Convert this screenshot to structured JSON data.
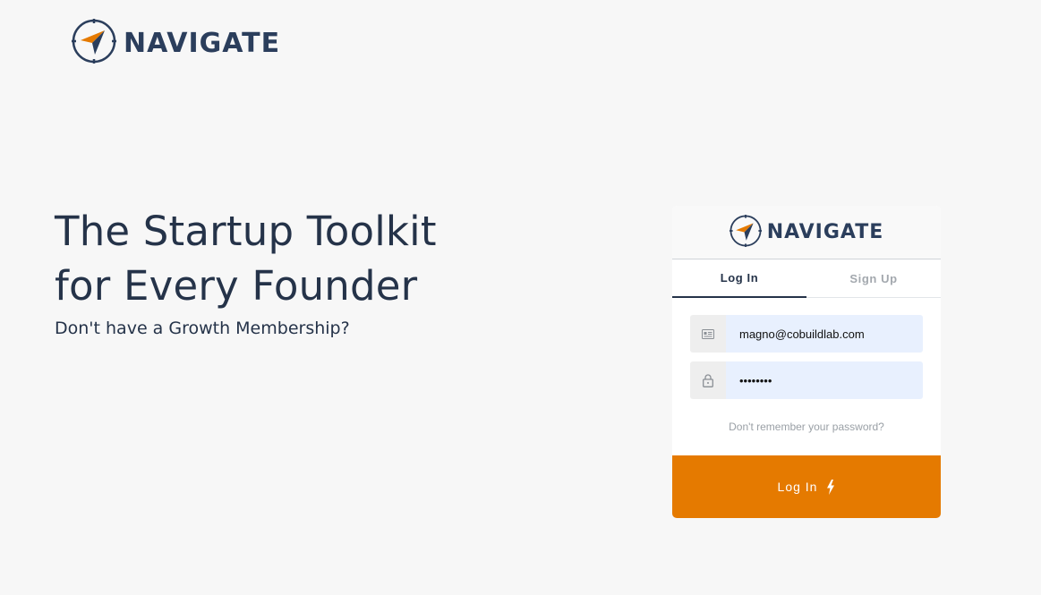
{
  "brand": {
    "name": "NAVIGATE",
    "logo_icon": "compass-icon",
    "colors": {
      "navy": "#2b3e5c",
      "orange": "#e57a00"
    }
  },
  "hero": {
    "title_line1": "The Startup Toolkit",
    "title_line2": "for Every Founder",
    "subtitle": "Don't have a Growth Membership?"
  },
  "login_card": {
    "tabs": [
      {
        "label": "Log In",
        "active": true
      },
      {
        "label": "Sign Up",
        "active": false
      }
    ],
    "email": {
      "value": "magno@cobuildlab.com",
      "icon": "id-card-icon"
    },
    "password": {
      "value": "••••••••",
      "icon": "lock-icon"
    },
    "forgot_link": "Don't remember your password?",
    "submit_label": "Log In",
    "submit_icon": "lightning-icon"
  }
}
